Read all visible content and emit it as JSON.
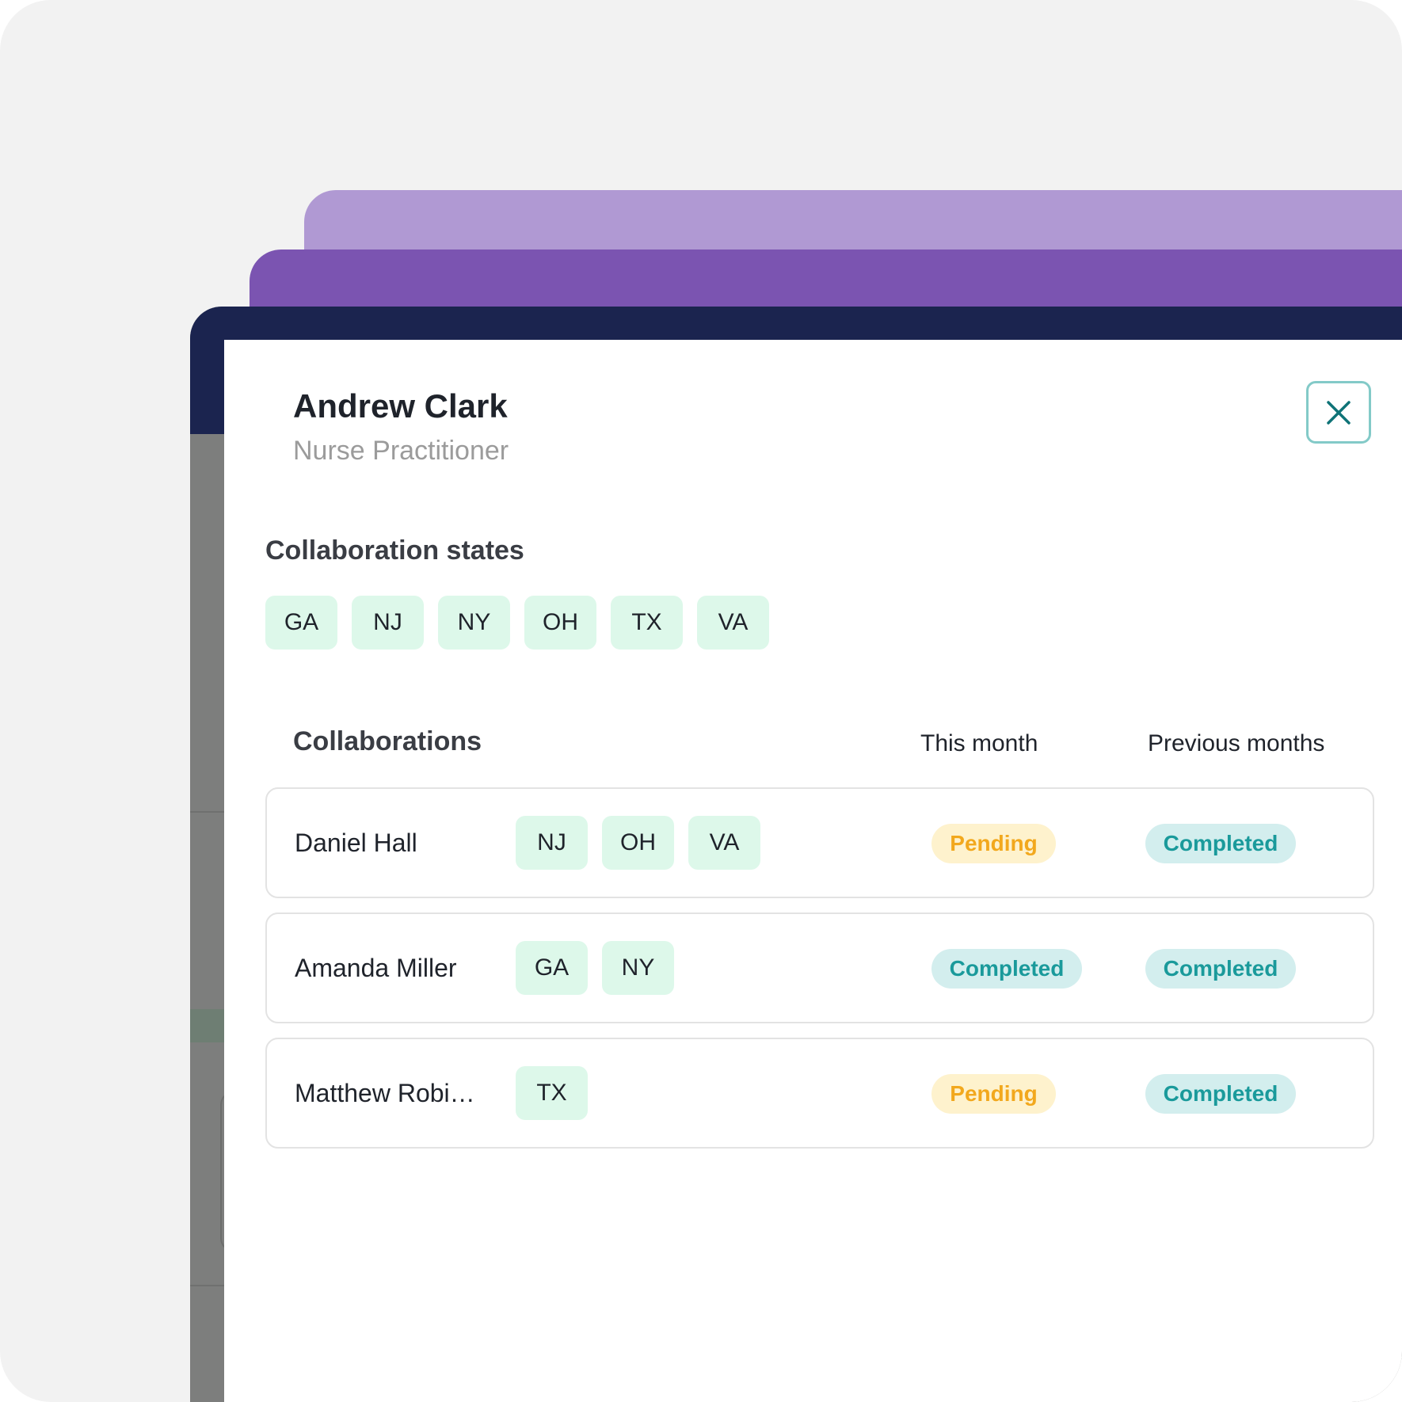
{
  "colors": {
    "background": "#f2f2f2",
    "layer_light_purple": "#b099d3",
    "layer_purple": "#7b54b1",
    "app_header_navy": "#1b244f",
    "chip_green": "#ddf8ea",
    "pending_bg": "#fef2cd",
    "pending_text": "#f2a81d",
    "completed_bg": "#d3eeee",
    "completed_text": "#1a9a9b",
    "close_border": "#83cac8"
  },
  "profile": {
    "name": "Andrew Clark",
    "role": "Nurse Practitioner",
    "close_icon": "close-icon"
  },
  "collaboration_states": {
    "heading": "Collaboration states",
    "states": [
      "GA",
      "NJ",
      "NY",
      "OH",
      "TX",
      "VA"
    ]
  },
  "collaborations": {
    "heading": "Collaborations",
    "columns": {
      "this_month": "This month",
      "previous_months": "Previous months"
    },
    "rows": [
      {
        "name": "Daniel Hall",
        "states": [
          "NJ",
          "OH",
          "VA"
        ],
        "this_month": "Pending",
        "previous_months": "Completed"
      },
      {
        "name": "Amanda Miller",
        "states": [
          "GA",
          "NY"
        ],
        "this_month": "Completed",
        "previous_months": "Completed"
      },
      {
        "name": "Matthew Robi…",
        "states": [
          "TX"
        ],
        "this_month": "Pending",
        "previous_months": "Completed"
      }
    ]
  }
}
